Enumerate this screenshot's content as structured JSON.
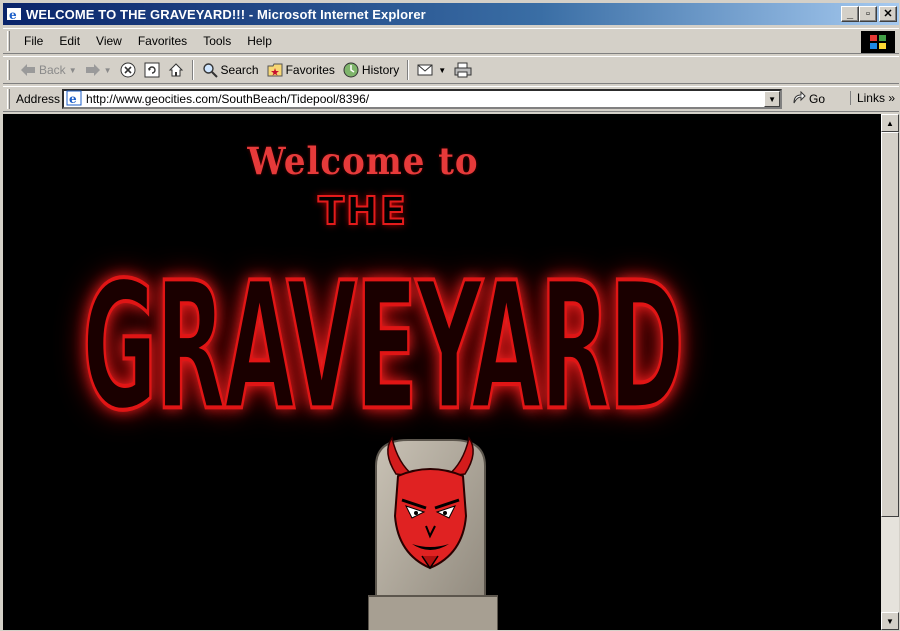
{
  "window": {
    "title": "WELCOME TO THE GRAVEYARD!!! - Microsoft Internet Explorer"
  },
  "menu": {
    "items": [
      "File",
      "Edit",
      "View",
      "Favorites",
      "Tools",
      "Help"
    ]
  },
  "toolbar": {
    "back": "Back",
    "search": "Search",
    "favorites": "Favorites",
    "history": "History"
  },
  "address": {
    "label": "Address",
    "url": "http://www.geocities.com/SouthBeach/Tidepool/8396/",
    "go": "Go",
    "links": "Links"
  },
  "page": {
    "welcome": "Welcome to",
    "the": "THE",
    "graveyard": "GRAVEYARD"
  },
  "colors": {
    "titlebar": "#0a246a",
    "accent_red": "#e01515",
    "background": "#000000"
  }
}
